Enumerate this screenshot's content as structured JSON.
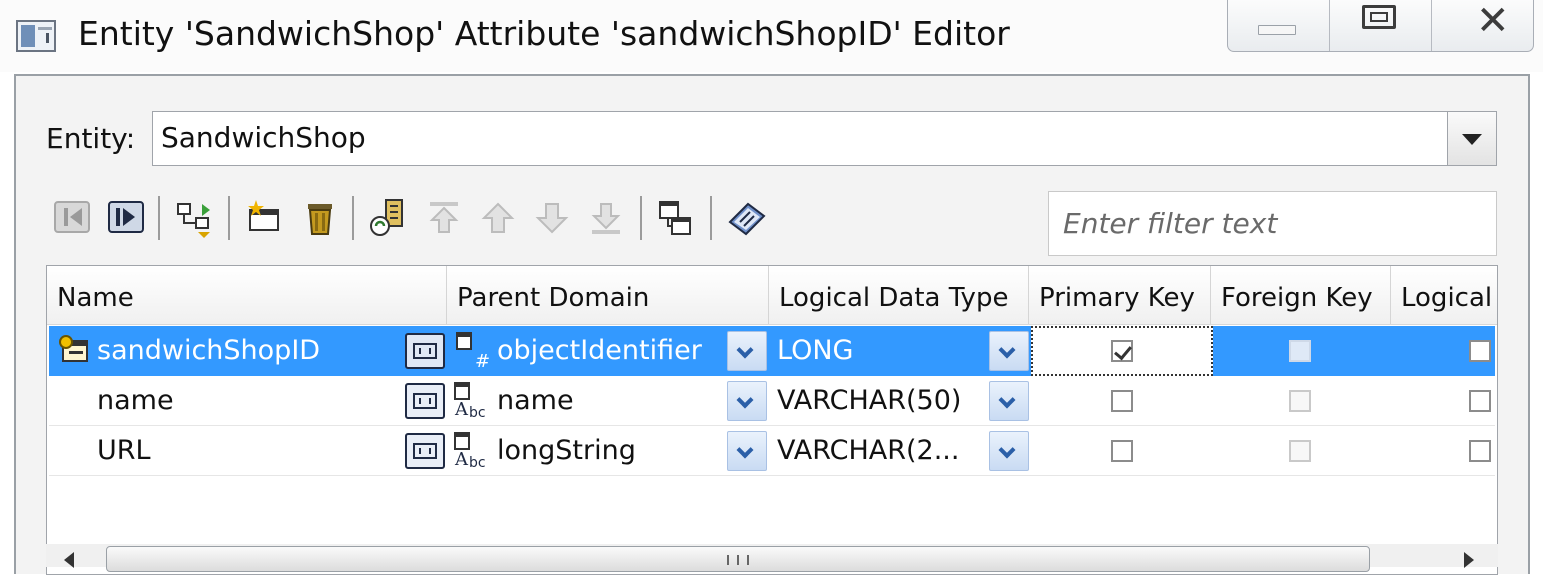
{
  "window": {
    "title": "Entity 'SandwichShop' Attribute 'sandwichShopID' Editor",
    "controls": [
      "minimize",
      "maximize",
      "close"
    ]
  },
  "entity": {
    "label": "Entity:",
    "value": "SandwichShop"
  },
  "toolbar": {
    "icons": [
      "collapse-left-icon",
      "expand-right-icon",
      "attribute-tree-icon",
      "new-attribute-icon",
      "delete-icon",
      "generate-icon",
      "move-top-icon",
      "move-up-icon",
      "move-down-icon",
      "move-bottom-icon",
      "copy-attribute-icon",
      "properties-icon"
    ]
  },
  "filter": {
    "placeholder": "Enter filter text",
    "value": ""
  },
  "table": {
    "columns": [
      "Name",
      "Parent Domain",
      "Logical Data Type",
      "Primary Key",
      "Foreign Key",
      "Logical"
    ],
    "rows": [
      {
        "name": "sandwichShopID",
        "domain": "objectIdentifier",
        "domain_icon": "numeric-domain-icon",
        "data_type": "LONG",
        "primary_key": true,
        "foreign_key": false,
        "logical": false,
        "selected": true
      },
      {
        "name": "name",
        "domain": "name",
        "domain_icon": "string-domain-icon",
        "data_type": "VARCHAR(50)",
        "primary_key": false,
        "foreign_key": false,
        "logical": false,
        "selected": false
      },
      {
        "name": "URL",
        "domain": "longString",
        "domain_icon": "string-domain-icon",
        "data_type": "VARCHAR(2...",
        "primary_key": false,
        "foreign_key": false,
        "logical": false,
        "selected": false
      }
    ]
  },
  "colors": {
    "selection": "#3399ff",
    "window_bg": "#f3f3f3"
  }
}
